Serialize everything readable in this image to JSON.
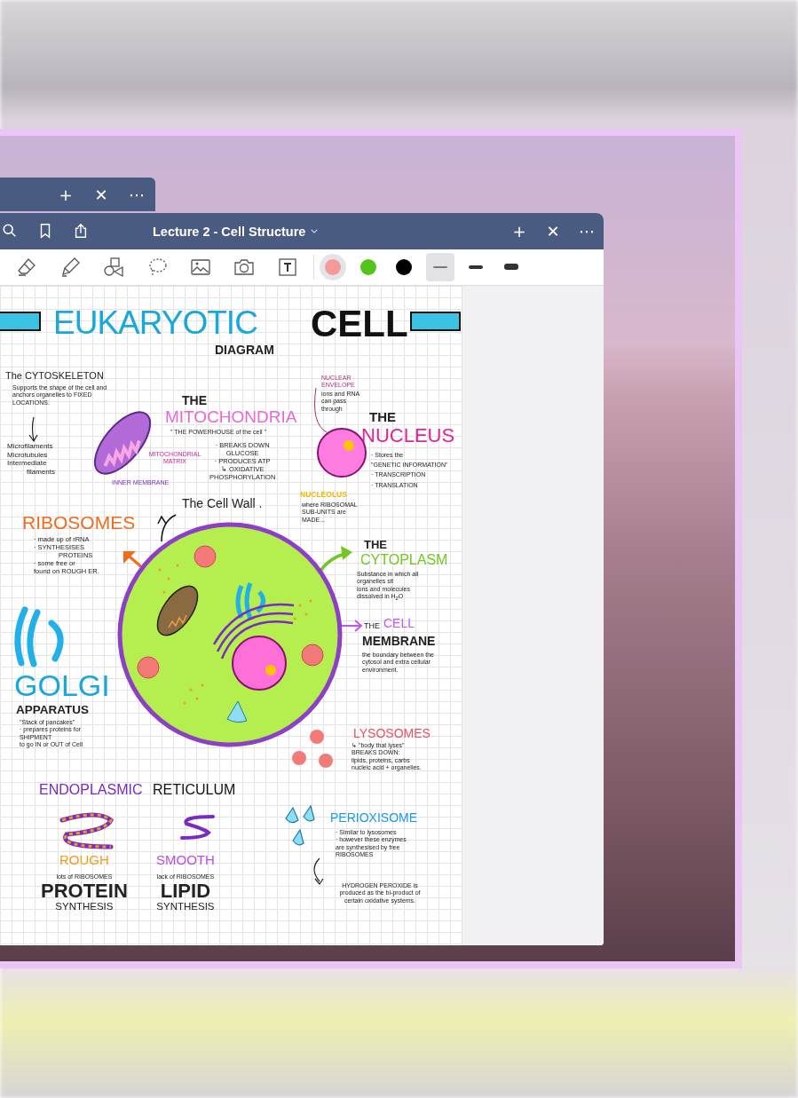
{
  "back_window": {
    "buttons": [
      "+",
      "✕",
      "⋯"
    ]
  },
  "window": {
    "title": "Lecture 2 - Cell Structure",
    "buttons": [
      "+",
      "✕",
      "⋯"
    ]
  },
  "toolbar": {
    "colors": [
      {
        "color": "#f49a9a",
        "selected": true
      },
      {
        "color": "#52c41a",
        "selected": false
      },
      {
        "color": "#000000",
        "selected": false
      }
    ],
    "widths": [
      {
        "selected": true
      },
      {
        "selected": false
      },
      {
        "selected": false
      }
    ]
  },
  "note": {
    "title": {
      "main": "EUKARYOTIC",
      "second": "CELL",
      "sub": "DIAGRAM"
    },
    "cytoskeleton": {
      "heading": "The CYTOSKELETON",
      "text": "Supports the shape of the cell and anchors organelles to FIXED LOCATIONS.",
      "items": [
        "Microfilaments",
        "Microtubules",
        "Intermediate",
        "filaments"
      ]
    },
    "mitochondria": {
      "pre": "THE",
      "heading": "MITOCHONDRIA",
      "quote": "\" THE POWERHOUSE of the cell \"",
      "lines": [
        "· BREAKS DOWN",
        "GLUCOSE",
        "· PRODUCES ATP",
        "↳ OXIDATIVE",
        "PHOSPHORYLATION"
      ],
      "matrix_label": "MITOCHONDRIAL MATRIX",
      "membrane_label": "INNER MEMBRANE"
    },
    "nucleus": {
      "envelope_label": "NUCLEAR ENVELOPE",
      "envelope_text": "ions and RNA can pass through",
      "nucleolus_label": "NUCLEOLUS",
      "nucleolus_text": "where RIBOSOMAL SUB-UNITS are MADE...",
      "pre": "THE",
      "heading": "NUCLEUS",
      "lines": [
        "· Stores the",
        "\"GENETIC INFORMATION\"",
        "· TRANSCRIPTION",
        "· TRANSLATION"
      ]
    },
    "cell_wall": "The Cell Wall .",
    "ribosomes": {
      "heading": "RIBOSOMES",
      "lines": [
        "· made up of rRNA",
        "· SYNTHESISES",
        "PROTEINS",
        "· some free or",
        "found on ROUGH ER."
      ]
    },
    "cytoplasm": {
      "pre": "THE",
      "heading": "CYTOPLASM",
      "lines": [
        "Substance in which all",
        "organelles sit",
        "ions and molecules",
        "dissolved in H$_{2}$O"
      ]
    },
    "cell_membrane": {
      "pre": "THE",
      "heading": "CELL",
      "heading_2": "MEMBRANE",
      "text": "the boundary between the cytosol and extra cellular environment."
    },
    "golgi": {
      "heading": "GOLGI",
      "sub": "APPARATUS",
      "lines": [
        "\"Stack of pancakes\"",
        "· prepares proteins for",
        "SHIPMENT",
        "to go IN or OUT of Cell"
      ]
    },
    "lysosomes": {
      "heading": "LYSOSOMES",
      "lines": [
        "↳ \"body that lyses\"",
        "BREAKS DOWN:",
        "lipids, proteins, carbs",
        "nucleic acid + organelles."
      ]
    },
    "er": {
      "heading": "ENDOPLASMIC",
      "heading_2": "RETICULUM",
      "rough": {
        "heading": "ROUGH",
        "text": "lots of RIBOSOMES",
        "big": "PROTEIN",
        "small": "SYNTHESIS"
      },
      "smooth": {
        "heading": "SMOOTH",
        "text": "lack of RIBOSOMES",
        "big": "LIPID",
        "small": "SYNTHESIS"
      }
    },
    "peroxisome": {
      "heading": "PERIOXISOME",
      "lines": [
        "· Similar to lysosomes",
        "· however these enzymes",
        "are synthesised by free",
        "RIBOSOMES"
      ],
      "note": "HYDROGEN PEROXIDE is produced as the bi-product of certain oxidative systems."
    }
  }
}
